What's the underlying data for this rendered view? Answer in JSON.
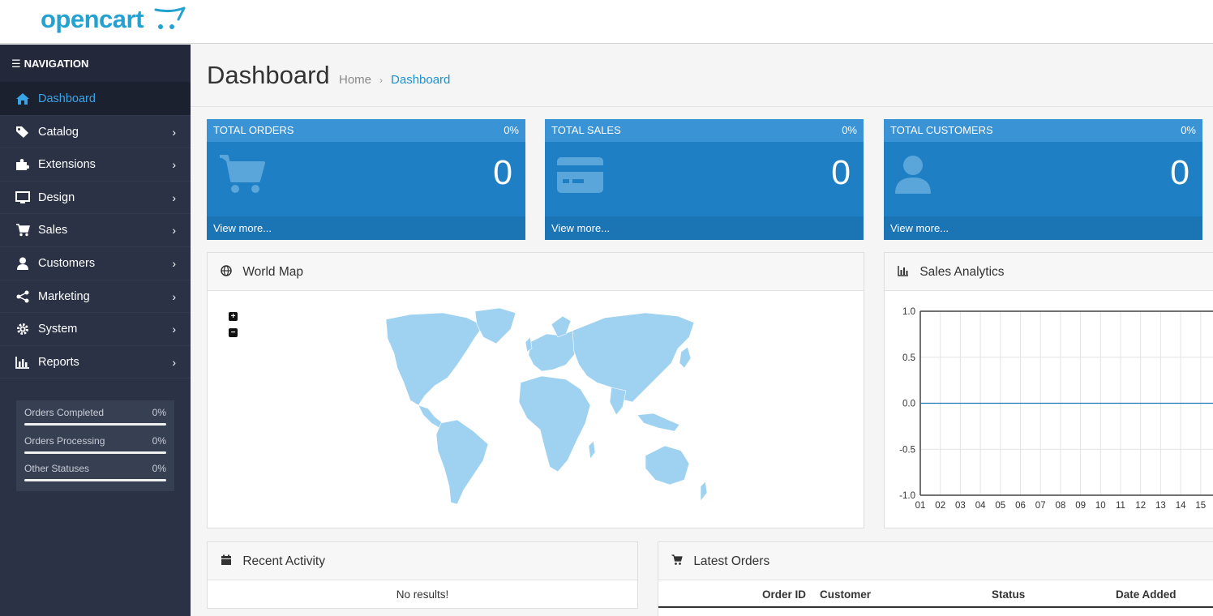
{
  "header": {
    "logo_text": "opencart"
  },
  "sidebar": {
    "title": "NAVIGATION",
    "items": [
      {
        "label": "Dashboard",
        "icon": "home-icon"
      },
      {
        "label": "Catalog",
        "icon": "tag-icon"
      },
      {
        "label": "Extensions",
        "icon": "puzzle-icon"
      },
      {
        "label": "Design",
        "icon": "monitor-icon"
      },
      {
        "label": "Sales",
        "icon": "cart-icon"
      },
      {
        "label": "Customers",
        "icon": "user-icon"
      },
      {
        "label": "Marketing",
        "icon": "share-icon"
      },
      {
        "label": "System",
        "icon": "gear-icon"
      },
      {
        "label": "Reports",
        "icon": "bar-chart-icon"
      }
    ],
    "statuses": [
      {
        "label": "Orders Completed",
        "value": "0%"
      },
      {
        "label": "Orders Processing",
        "value": "0%"
      },
      {
        "label": "Other Statuses",
        "value": "0%"
      }
    ]
  },
  "page": {
    "title": "Dashboard",
    "breadcrumb": [
      "Home",
      "Dashboard"
    ]
  },
  "tiles": [
    {
      "title": "TOTAL ORDERS",
      "percent": "0%",
      "value": "0",
      "link": "View more...",
      "icon": "cart-icon"
    },
    {
      "title": "TOTAL SALES",
      "percent": "0%",
      "value": "0",
      "link": "View more...",
      "icon": "credit-card-icon"
    },
    {
      "title": "TOTAL CUSTOMERS",
      "percent": "0%",
      "value": "0",
      "link": "View more...",
      "icon": "user-icon"
    }
  ],
  "world_map": {
    "title": "World Map",
    "zoom_in": "+",
    "zoom_out": "−"
  },
  "sales_analytics": {
    "title": "Sales Analytics"
  },
  "chart_data": {
    "type": "line",
    "x": [
      "01",
      "02",
      "03",
      "04",
      "05",
      "06",
      "07",
      "08",
      "09",
      "10",
      "11",
      "12",
      "13",
      "14",
      "15"
    ],
    "series": [
      {
        "values": [
          0,
          0,
          0,
          0,
          0,
          0,
          0,
          0,
          0,
          0,
          0,
          0,
          0,
          0,
          0
        ]
      }
    ],
    "yticks": [
      "1.0",
      "0.5",
      "0.0",
      "-0.5",
      "-1.0"
    ],
    "ylim": [
      -1.0,
      1.0
    ],
    "grid": true,
    "color": "#1e78b4"
  },
  "recent_activity": {
    "title": "Recent Activity",
    "empty_text": "No results!"
  },
  "latest_orders": {
    "title": "Latest Orders",
    "columns": [
      "Order ID",
      "Customer",
      "Status",
      "Date Added"
    ]
  },
  "colors": {
    "accent": "#1e91cf",
    "sidebar": "#2b3245",
    "tile": "#1e7fc4"
  }
}
